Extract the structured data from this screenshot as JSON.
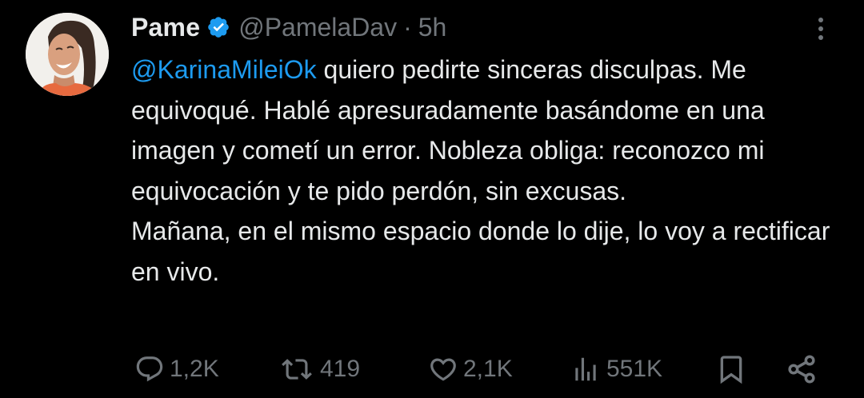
{
  "tweet": {
    "author_name": "Pame",
    "handle": "@PamelaDav",
    "separator": "·",
    "time": "5h",
    "mention": "@KarinaMileiOk",
    "first_line_rest": " quiero pedirte sinceras disculpas.",
    "paragraph1": "Me equivoqué. Hablé apresuradamente basándome en una imagen y cometí un error. Nobleza obliga: reconozco mi equivocación y te pido perdón, sin excusas.",
    "paragraph2": "Mañana, en el mismo espacio donde lo dije, lo voy a rectificar en vivo."
  },
  "stats": {
    "replies": "1,2K",
    "reposts": "419",
    "likes": "2,1K",
    "views": "551K"
  },
  "icons": {
    "verified": "verified-badge-icon",
    "more": "more-options-icon",
    "reply": "reply-icon",
    "repost": "repost-icon",
    "like": "heart-icon",
    "views": "views-icon",
    "bookmark": "bookmark-icon",
    "share": "share-icon"
  },
  "colors": {
    "background": "#000000",
    "text": "#e7e9ea",
    "muted": "#71767b",
    "mention": "#1d9bf0",
    "verified": "#1d9bf0"
  }
}
